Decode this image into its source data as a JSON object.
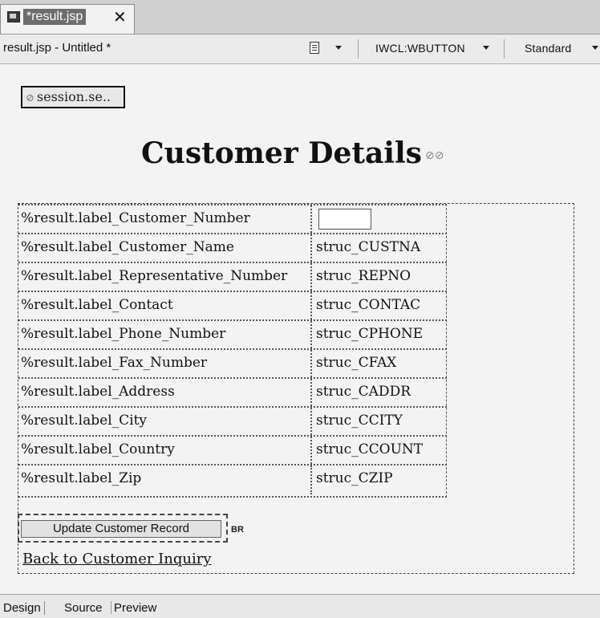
{
  "editor_tab": {
    "label": "*result.jsp",
    "close": "✕"
  },
  "toolbar": {
    "document_title": "result.jsp - Untitled *",
    "tag_dropdown": "IWCL:WBUTTON",
    "style_dropdown": "Standard"
  },
  "page": {
    "session_button": "session.se..",
    "heading": "Customer Details",
    "rows": [
      {
        "label": "%result.label_Customer_Number",
        "value": ""
      },
      {
        "label": "%result.label_Customer_Name",
        "value": "struc_CUSTNA"
      },
      {
        "label": "%result.label_Representative_Number",
        "value": "struc_REPNO"
      },
      {
        "label": "%result.label_Contact",
        "value": "struc_CONTAC"
      },
      {
        "label": "%result.label_Phone_Number",
        "value": "struc_CPHONE"
      },
      {
        "label": "%result.label_Fax_Number",
        "value": "struc_CFAX"
      },
      {
        "label": "%result.label_Address",
        "value": "struc_CADDR"
      },
      {
        "label": "%result.label_City",
        "value": "struc_CCITY"
      },
      {
        "label": "%result.label_Country",
        "value": "struc_CCOUNT"
      },
      {
        "label": "%result.label_Zip",
        "value": "struc_CZIP"
      }
    ],
    "update_button": "Update Customer Record",
    "br_marker": "BR",
    "back_link": "Back to Customer Inquiry"
  },
  "mode_tabs": [
    "Design",
    "Source",
    "Preview"
  ]
}
